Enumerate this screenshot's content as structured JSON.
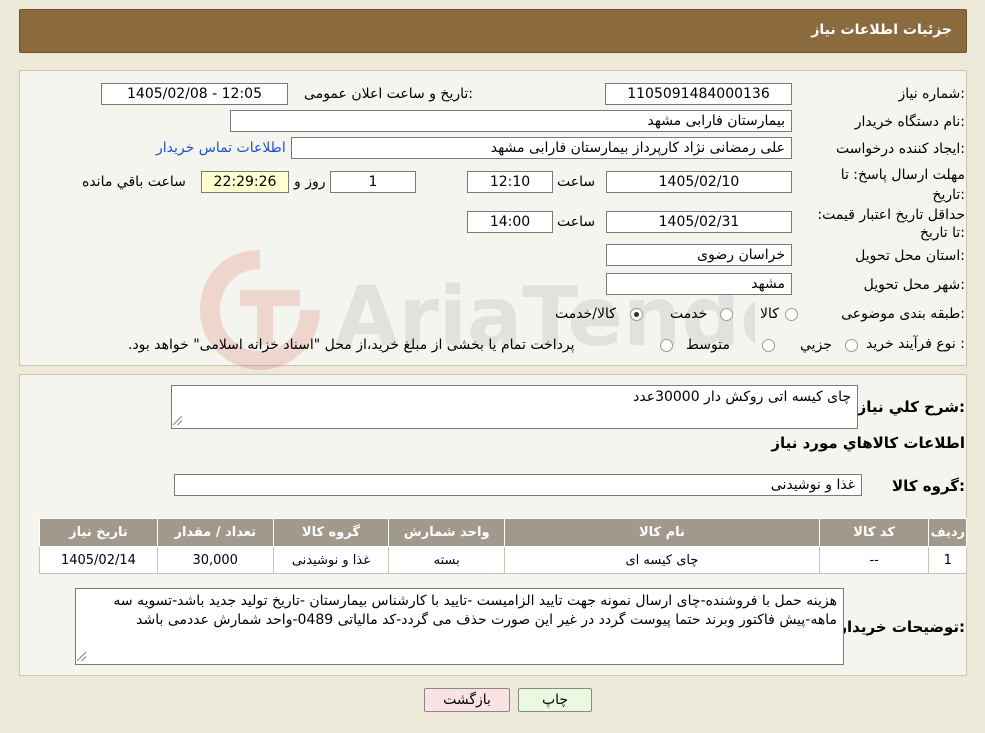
{
  "header": {
    "title": "جزئیات اطلاعات نیاز"
  },
  "watermark": {
    "text": "AriaTender.neT"
  },
  "form": {
    "need_number_label": "شماره نیاز:",
    "need_number": "1105091484000136",
    "announce_label": "تاریخ و ساعت اعلان عمومی:",
    "announce_value": "1405/02/08 - 12:05",
    "buyer_org_label": "نام دستگاه خریدار:",
    "buyer_org": "بیمارستان فارابی مشهد",
    "requester_label": "ایجاد کننده درخواست:",
    "requester": "علی رمضانی نژاد کارپرداز بیمارستان فارابی مشهد",
    "contact_link": "اطلاعات تماس خریدار",
    "deadline_label": "مهلت ارسال پاسخ: تا تاریخ:",
    "deadline_date": "1405/02/10",
    "time_label": "ساعت",
    "deadline_time": "12:10",
    "days": "1",
    "days_label": "روز و",
    "remaining": "22:29:26",
    "remaining_label": "ساعت باقي مانده",
    "validity_label": "حداقل تاریخ اعتبار قیمت: تا تاریخ:",
    "validity_date": "1405/02/31",
    "validity_time": "14:00",
    "province_label": "استان محل تحویل:",
    "province": "خراسان رضوی",
    "city_label": "شهر محل تحویل:",
    "city": "مشهد",
    "category_label": "طبقه بندی موضوعی:",
    "category_options": [
      "کالا",
      "خدمت",
      "کالا/خدمت"
    ],
    "process_label": "نوع فرآیند خرید :",
    "process_options": [
      "جزیي",
      "متوسط"
    ],
    "payment_note": "پرداخت تمام یا بخشی از مبلغ خرید،از محل \"اسناد خزانه اسلامی\" خواهد بود."
  },
  "details": {
    "summary_label": "شرح کلي نیاز:",
    "summary": "چای کیسه اتی روکش دار 30000عدد",
    "goods_info_title": "اطلاعات کالاهاي مورد نیاز",
    "goods_group_label": "گروه کالا:",
    "goods_group": "غذا و نوشیدنی",
    "table": {
      "headers": [
        "ردیف",
        "کد کالا",
        "نام کالا",
        "واحد شمارش",
        "گروه کالا",
        "تعداد / مقدار",
        "تاریخ نیاز"
      ],
      "rows": [
        [
          "1",
          "--",
          "چای کیسه ای",
          "بسته",
          "غذا و نوشیدنی",
          "30,000",
          "1405/02/14"
        ]
      ]
    },
    "buyer_notes_label": "توضیحات خریدار:",
    "buyer_notes": "هزینه حمل با فروشنده-چای  ارسال نمونه جهت تایید الزامیست -تایید با کارشناس بیمارستان -تاریخ تولید جدید باشد-تسویه سه ماهه-پیش فاکتور وبرند حتما پیوست گردد در غیر این صورت حذف می گردد-کد مالیاتی 0489-واحد شمارش عددمی باشد"
  },
  "buttons": {
    "print": "چاپ",
    "back": "بازگشت"
  },
  "colors": {
    "header": "#8b6a3e",
    "table_header": "#a19a8c",
    "print_btn": "#eafae0",
    "back_btn": "#fbe3e3"
  }
}
